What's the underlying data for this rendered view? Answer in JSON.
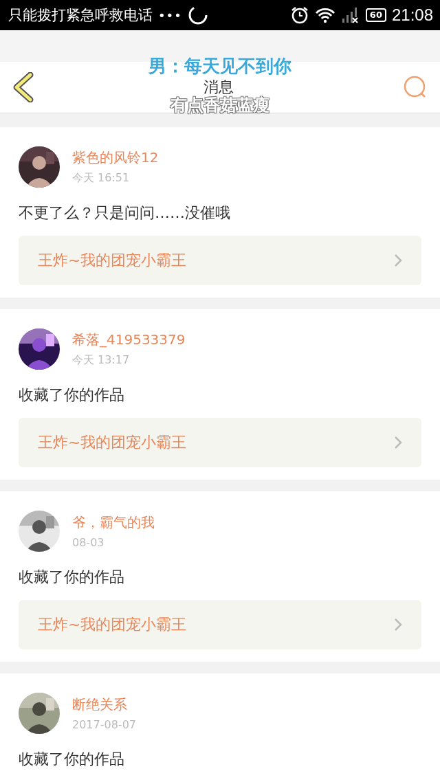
{
  "status_bar": {
    "carrier": "只能拨打紧急呼救电话",
    "dots": "•••",
    "battery": "60",
    "time": "21:08"
  },
  "header": {
    "title": "消息"
  },
  "lyrics_overlay": {
    "line_1": "男：每天见不到你",
    "line_2": "有点香菇蓝瘦"
  },
  "messages": [
    {
      "name": "紫色的风铃12",
      "time": "今天 16:51",
      "text": "不更了么？只是问问……没催哦",
      "work": "王炸~我的团宠小霸王"
    },
    {
      "name": "希落_419533379",
      "time": "今天 13:17",
      "text": "收藏了你的作品",
      "work": "王炸~我的团宠小霸王"
    },
    {
      "name": "爷，霸气的我",
      "time": "08-03",
      "text": "收藏了你的作品",
      "work": "王炸~我的团宠小霸王"
    },
    {
      "name": "断绝关系",
      "time": "2017-08-07",
      "text": "收藏了你的作品"
    }
  ]
}
